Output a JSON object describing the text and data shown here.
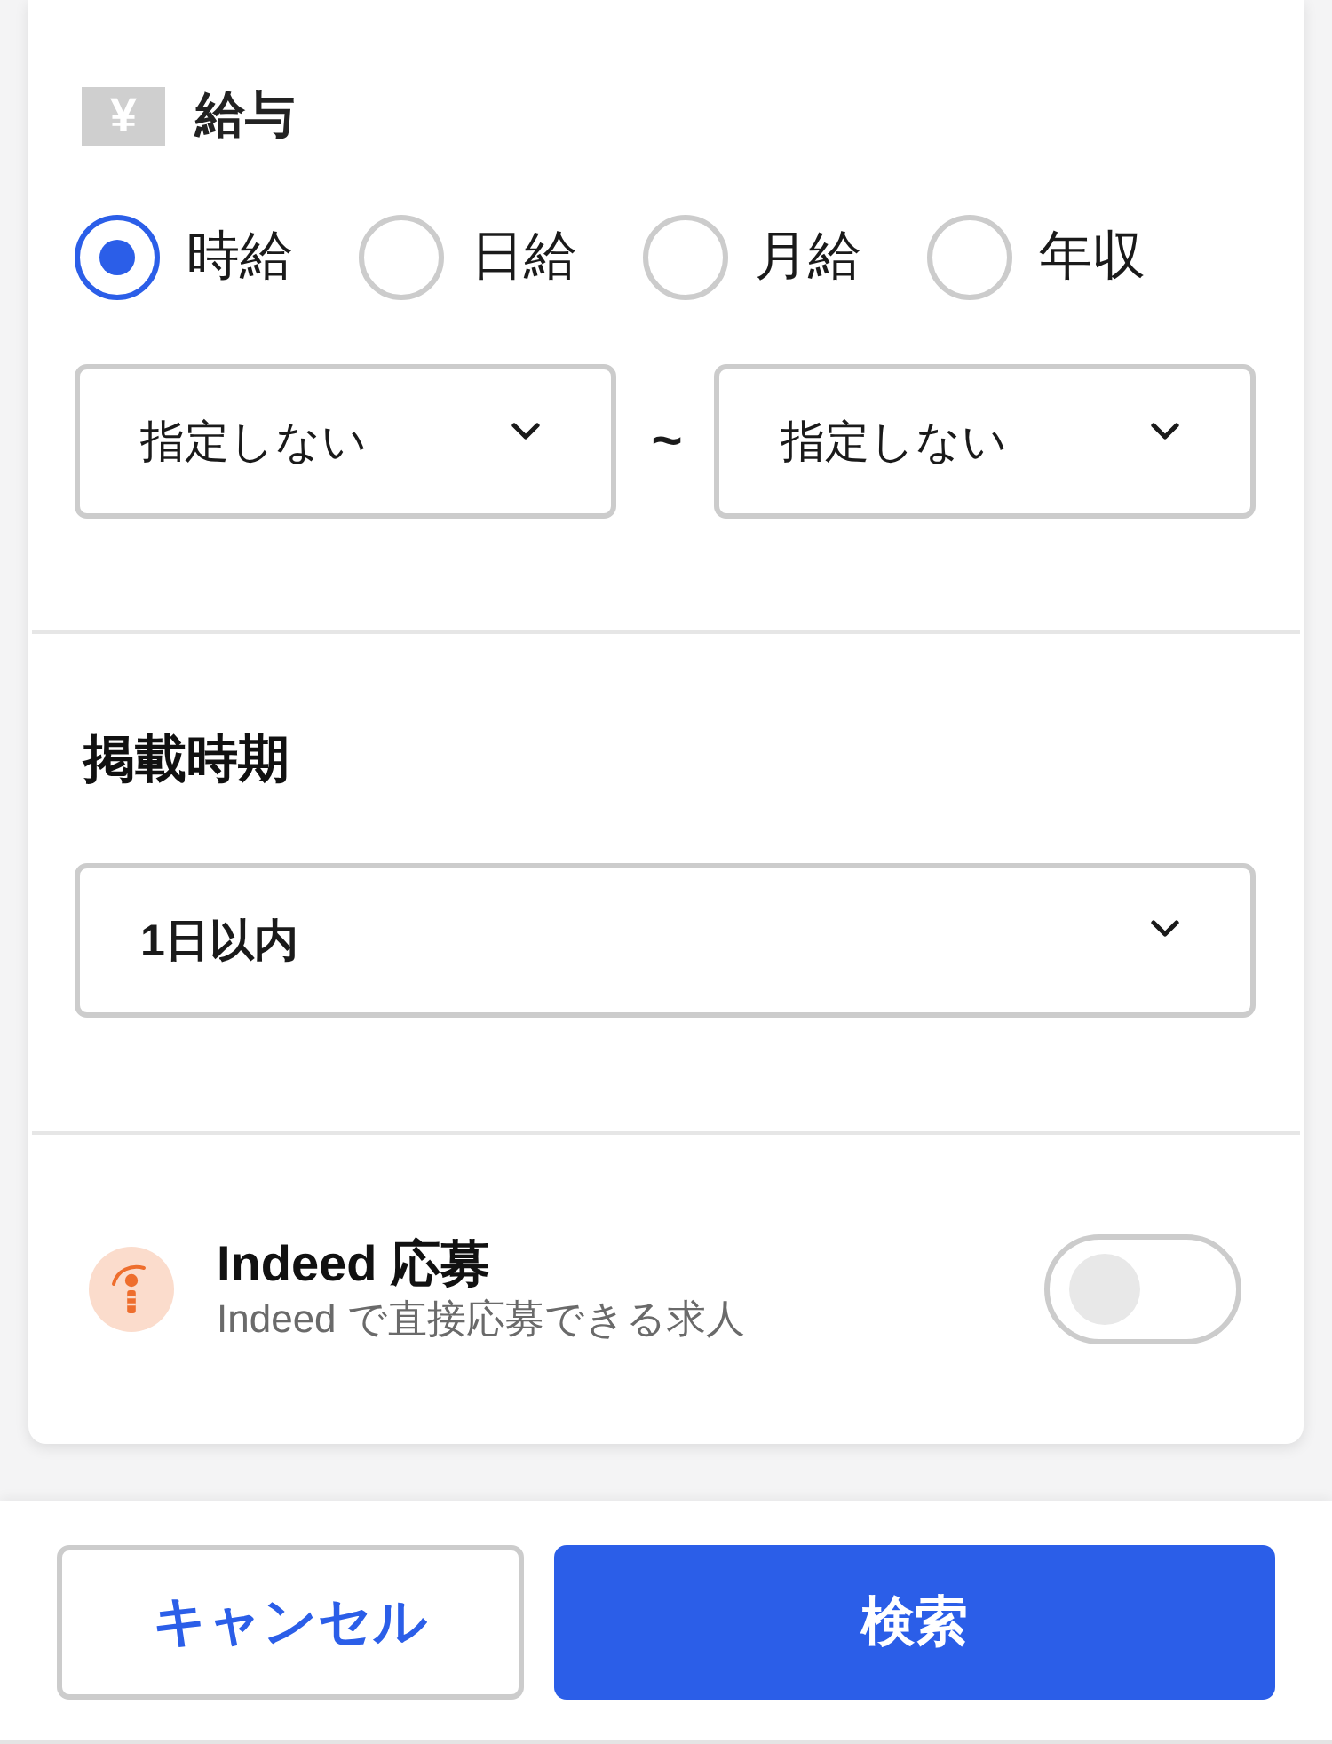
{
  "salary": {
    "currency_symbol": "¥",
    "title": "給与",
    "pay_types": [
      {
        "label": "時給",
        "selected": true
      },
      {
        "label": "日給",
        "selected": false
      },
      {
        "label": "月給",
        "selected": false
      },
      {
        "label": "年収",
        "selected": false
      }
    ],
    "range": {
      "min": {
        "value": "指定しない"
      },
      "separator": "~",
      "max": {
        "value": "指定しない"
      }
    }
  },
  "posting_period": {
    "title": "掲載時期",
    "select": {
      "value": "1日以内"
    }
  },
  "indeed_apply": {
    "title": "Indeed 応募",
    "description": "Indeed で直接応募できる求人",
    "on": false
  },
  "buttons": [
    {
      "label": "キャンセル",
      "kind": "secondary"
    },
    {
      "label": "検索",
      "kind": "primary"
    }
  ]
}
